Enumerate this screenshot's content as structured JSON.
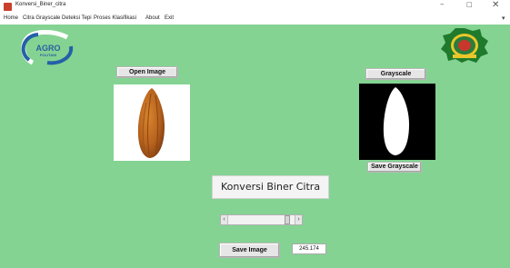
{
  "window": {
    "title": "Konversi_Biner_citra"
  },
  "menu": {
    "items": [
      "Home",
      "Citra Grayscale",
      "Deteksi Tepi",
      "Proses Klasifikasi",
      "About",
      "Exit"
    ],
    "overflow_arrow": "▾"
  },
  "window_controls": {
    "minimize": "–",
    "maximize": "□",
    "close": "✕"
  },
  "logos": {
    "left_text_line1": "AGRO",
    "left_text_line2": "POLITANI"
  },
  "buttons": {
    "open_image": "Open Image",
    "grayscale": "Grayscale",
    "save_grayscale": "Save Grayscale",
    "save_image": "Save Image"
  },
  "title_label": "Konversi Biner Citra",
  "slider": {
    "value_display": "245.174",
    "position_fraction": 0.92
  },
  "icons": [
    "app-icon",
    "agro-logo",
    "university-emblem",
    "cacao-pod-image",
    "binary-mask-image"
  ],
  "colors": {
    "background": "#84d392",
    "button": "#e6e6e6",
    "cacao": "#b7621d"
  }
}
